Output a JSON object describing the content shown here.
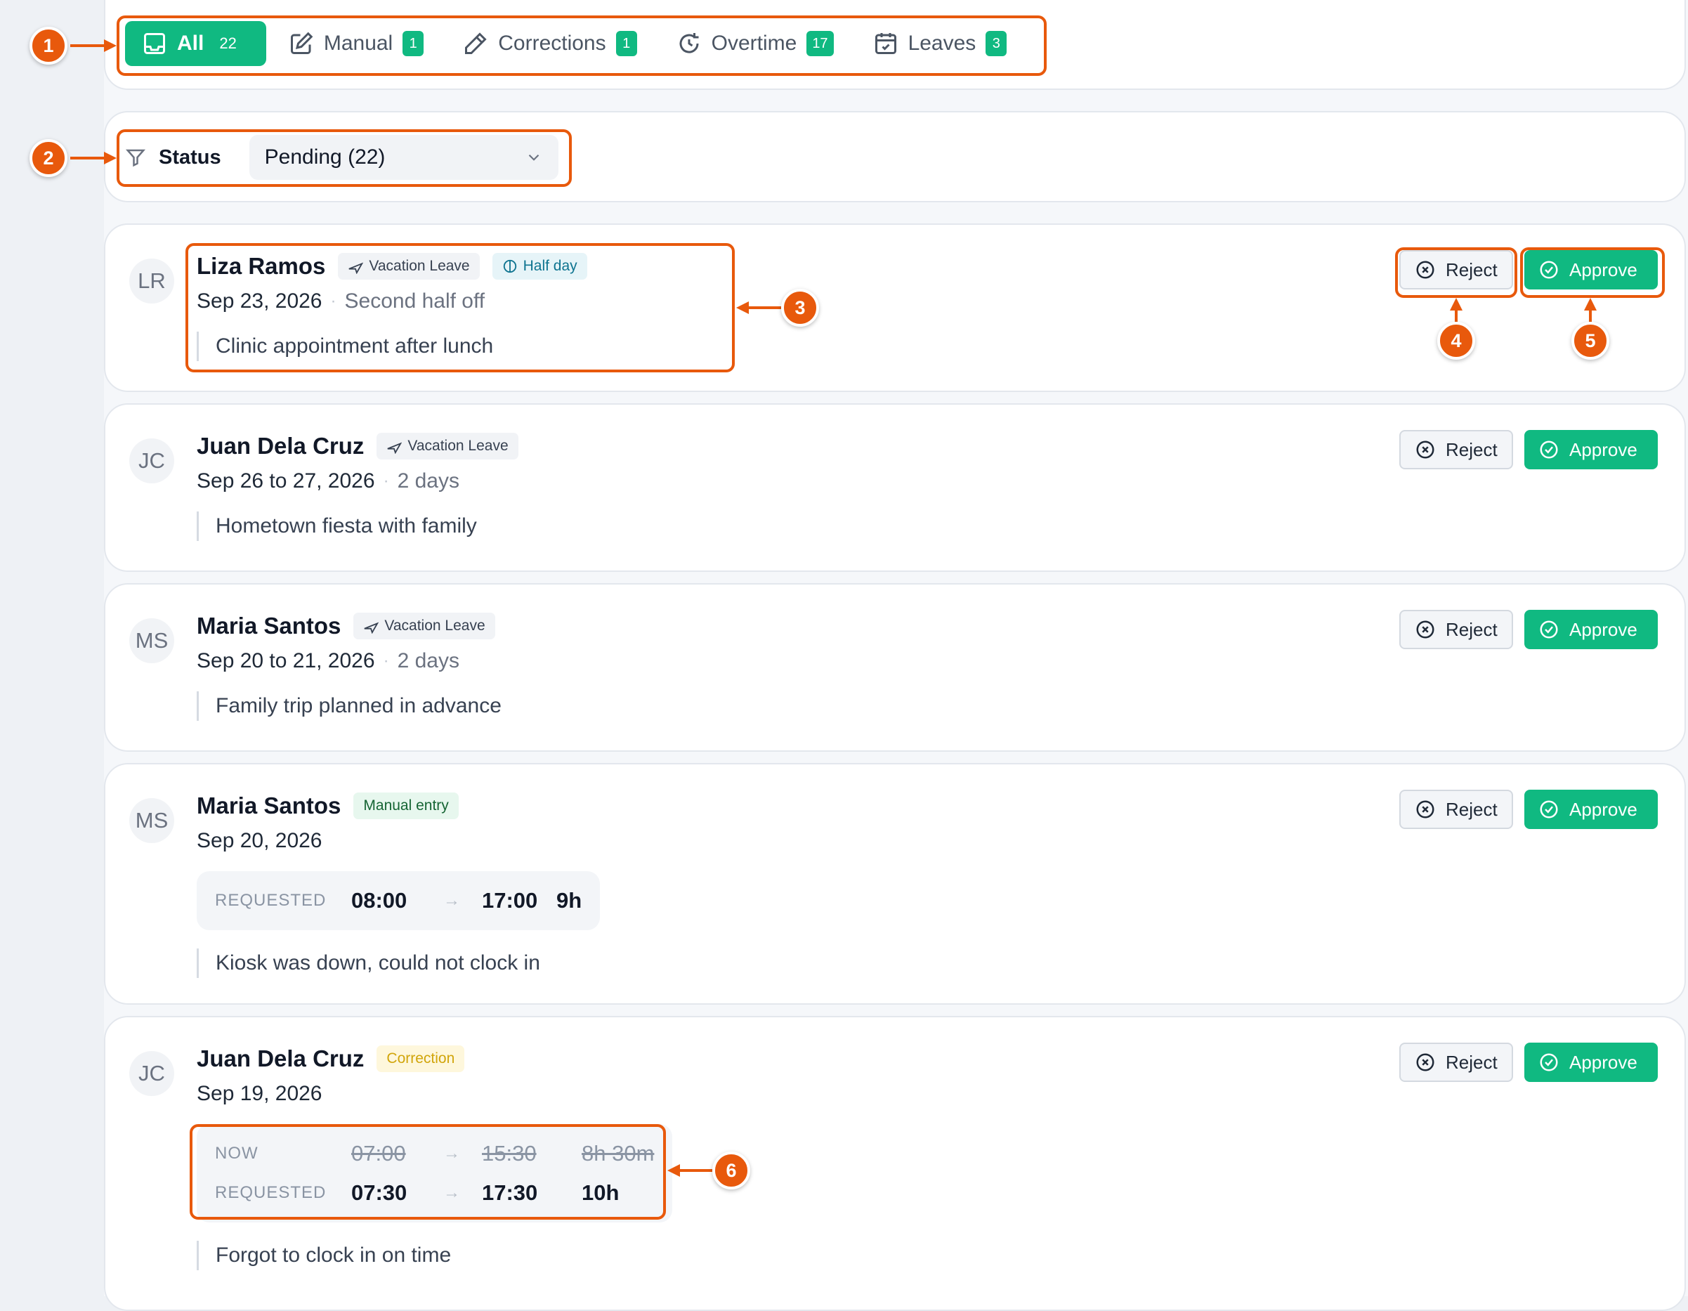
{
  "tabs": [
    {
      "label": "All",
      "count": "22",
      "icon": "inbox-icon"
    },
    {
      "label": "Manual",
      "count": "1",
      "icon": "edit-icon"
    },
    {
      "label": "Corrections",
      "count": "1",
      "icon": "pencil-icon"
    },
    {
      "label": "Overtime",
      "count": "17",
      "icon": "clock-rotate-icon"
    },
    {
      "label": "Leaves",
      "count": "3",
      "icon": "calendar-check-icon"
    }
  ],
  "filter": {
    "label": "Status",
    "value": "Pending (22)"
  },
  "buttons": {
    "reject": "Reject",
    "approve": "Approve"
  },
  "requests": [
    {
      "initials": "LR",
      "name": "Liza Ramos",
      "tag": "Vacation Leave",
      "tag2": "Half day",
      "date": "Sep 23, 2026",
      "extra": "Second half off",
      "note": "Clinic appointment after lunch"
    },
    {
      "initials": "JC",
      "name": "Juan Dela Cruz",
      "tag": "Vacation Leave",
      "date": "Sep 26 to 27, 2026",
      "extra": "2 days",
      "note": "Hometown fiesta with family"
    },
    {
      "initials": "MS",
      "name": "Maria Santos",
      "tag": "Vacation Leave",
      "date": "Sep 20 to 21, 2026",
      "extra": "2 days",
      "note": "Family trip planned in advance"
    },
    {
      "initials": "MS",
      "name": "Maria Santos",
      "tag": "Manual entry",
      "date": "Sep 20, 2026",
      "requested": {
        "label": "REQUESTED",
        "start": "08:00",
        "end": "17:00",
        "duration": "9h"
      },
      "note": "Kiosk was down, could not clock in"
    },
    {
      "initials": "JC",
      "name": "Juan Dela Cruz",
      "tag": "Correction",
      "date": "Sep 19, 2026",
      "now": {
        "label": "NOW",
        "start": "07:00",
        "end": "15:30",
        "duration": "8h 30m"
      },
      "requested": {
        "label": "REQUESTED",
        "start": "07:30",
        "end": "17:30",
        "duration": "10h"
      },
      "note": "Forgot to clock in on time"
    }
  ],
  "annotations": [
    "1",
    "2",
    "3",
    "4",
    "5",
    "6"
  ],
  "colors": {
    "accent": "#10b981",
    "annotation": "#e8590c",
    "half_day": "#0e7490",
    "correction": "#d1a50a"
  }
}
